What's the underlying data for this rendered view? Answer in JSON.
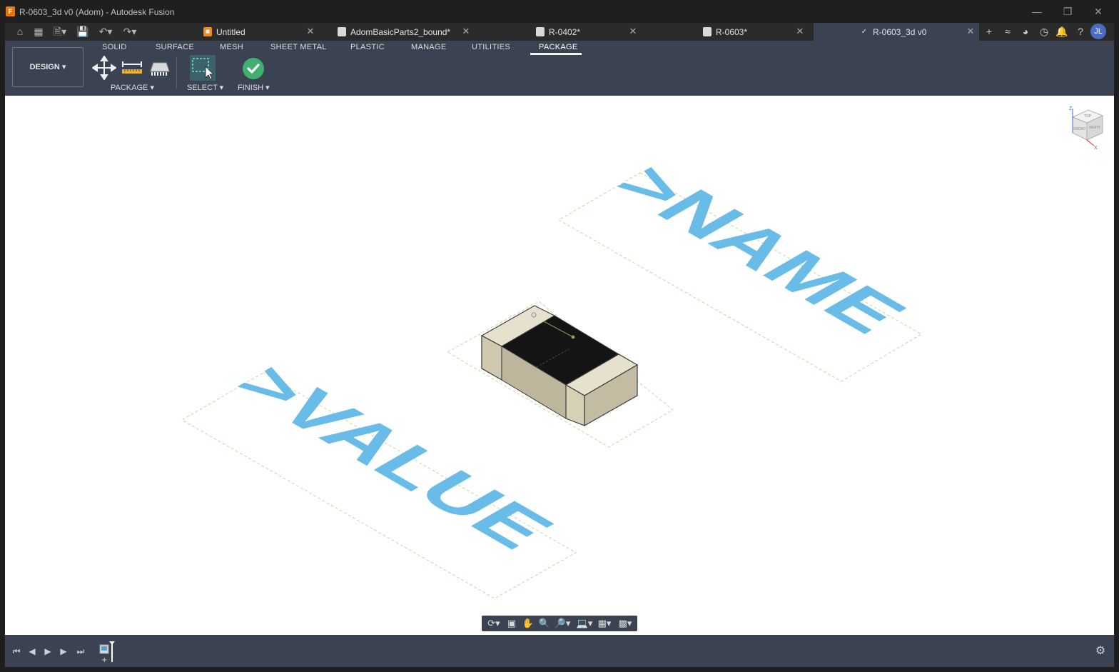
{
  "window": {
    "title": "R-0603_3d v0 (Adom) - Autodesk Fusion",
    "app_icon": "F",
    "app_icon_color": "#e8760b"
  },
  "tabs": [
    {
      "label": "Untitled",
      "icon": "box-icon",
      "active": false
    },
    {
      "label": "AdomBasicParts2_bound*",
      "icon": "document-icon",
      "active": false
    },
    {
      "label": "R-0402*",
      "icon": "document-icon",
      "active": false
    },
    {
      "label": "R-0603*",
      "icon": "document-icon",
      "active": false
    },
    {
      "label": "R-0603_3d v0",
      "icon": "check-icon",
      "active": true
    }
  ],
  "user": {
    "initials": "JL"
  },
  "toolbar": {
    "workspace_button": "DESIGN",
    "workspace_tabs": [
      "SOLID",
      "SURFACE",
      "MESH",
      "SHEET METAL",
      "PLASTIC",
      "MANAGE",
      "UTILITIES",
      "PACKAGE"
    ],
    "active_tab": "PACKAGE",
    "groups": {
      "package": "PACKAGE",
      "select": "SELECT",
      "finish": "FINISH"
    }
  },
  "canvas": {
    "name_label": ">NAME",
    "value_label": ">VALUE",
    "text_color": "#6abce8",
    "body_color": "#d8d2b8",
    "top_color": "#131313",
    "viewcube": {
      "top": "TOP",
      "front": "FRONT",
      "right": "RIGHT",
      "axis_z": "Z",
      "axis_x": "X"
    }
  },
  "colors": {
    "accent": "#3b4252",
    "finish_green": "#3fb06f",
    "select_highlight": "#3d8b8b"
  }
}
